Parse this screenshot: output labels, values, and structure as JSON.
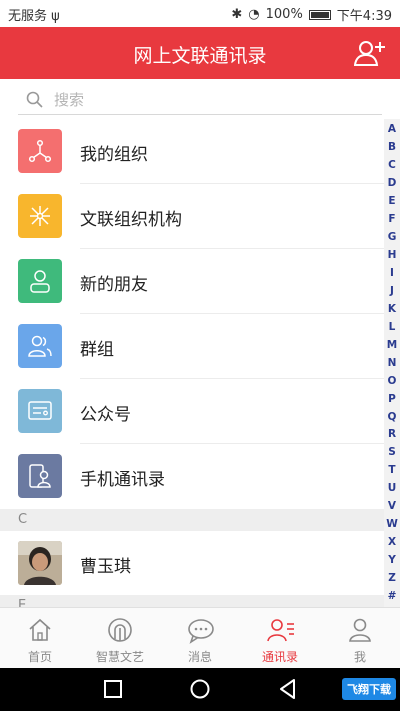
{
  "status_bar": {
    "carrier": "无服务 ψ",
    "battery": "100%",
    "time": "下午4:39"
  },
  "header": {
    "title": "网上文联通讯录",
    "add_icon": "add-contact-icon"
  },
  "search": {
    "placeholder": "搜索"
  },
  "menu_items": [
    {
      "label": "我的组织",
      "icon": "org-share-icon",
      "color": "#f46f6f"
    },
    {
      "label": "文联组织机构",
      "icon": "network-icon",
      "color": "#f8b62d"
    },
    {
      "label": "新的朋友",
      "icon": "person-icon",
      "color": "#3fba7c"
    },
    {
      "label": "群组",
      "icon": "group-icon",
      "color": "#6aa6ea"
    },
    {
      "label": "公众号",
      "icon": "card-icon",
      "color": "#7fb8d8"
    },
    {
      "label": "手机通讯录",
      "icon": "phone-contact-icon",
      "color": "#6b7aa1"
    }
  ],
  "sections": [
    {
      "letter": "C",
      "contacts": [
        {
          "name": "曹玉琪"
        }
      ]
    },
    {
      "letter": "E"
    }
  ],
  "index_letters": [
    "A",
    "B",
    "C",
    "D",
    "E",
    "F",
    "G",
    "H",
    "I",
    "J",
    "K",
    "L",
    "M",
    "N",
    "O",
    "P",
    "Q",
    "R",
    "S",
    "T",
    "U",
    "V",
    "W",
    "X",
    "Y",
    "Z",
    "#"
  ],
  "tabs": [
    {
      "label": "首页",
      "icon": "home-icon",
      "active": false
    },
    {
      "label": "智慧文艺",
      "icon": "art-icon",
      "active": false
    },
    {
      "label": "消息",
      "icon": "chat-icon",
      "active": false
    },
    {
      "label": "通讯录",
      "icon": "contacts-icon",
      "active": true
    },
    {
      "label": "我",
      "icon": "me-icon",
      "active": false
    }
  ],
  "colors": {
    "brand_red": "#e8393f",
    "index_blue": "#2a3b8f"
  },
  "watermark": "飞翔下载"
}
